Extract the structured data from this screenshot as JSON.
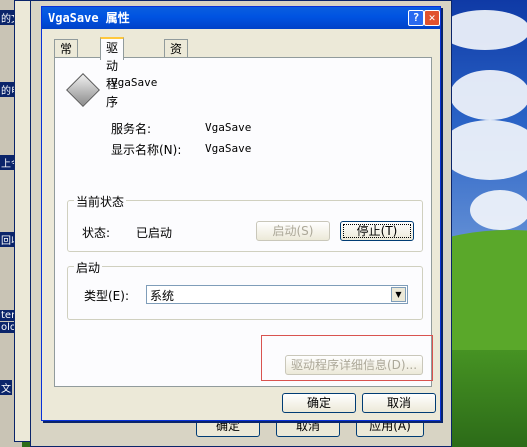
{
  "desktop": {
    "icon_labels": [
      "的文",
      "的电",
      "上令",
      "回收",
      "ter",
      "olo",
      "文"
    ]
  },
  "back_window_buttons": [
    "确定",
    "取消",
    "应用(A)"
  ],
  "dialog": {
    "title": "VgaSave 属性",
    "tabs": [
      "常规",
      "驱动程序",
      "资源"
    ],
    "active_tab": "驱动程序",
    "device_name": "VgaSave",
    "service_name_label": "服务名:",
    "service_name_value": "VgaSave",
    "display_name_label": "显示名称(N):",
    "display_name_value": "VgaSave",
    "current_status": {
      "legend": "当前状态",
      "status_label": "状态:",
      "status_value": "已启动",
      "start_button": "启动(S)",
      "stop_button": "停止(T)"
    },
    "startup": {
      "legend": "启动",
      "type_label": "类型(E):",
      "type_value": "系统"
    },
    "driver_details_button": "驱动程序详细信息(D)...",
    "ok_button": "确定",
    "cancel_button": "取消"
  }
}
